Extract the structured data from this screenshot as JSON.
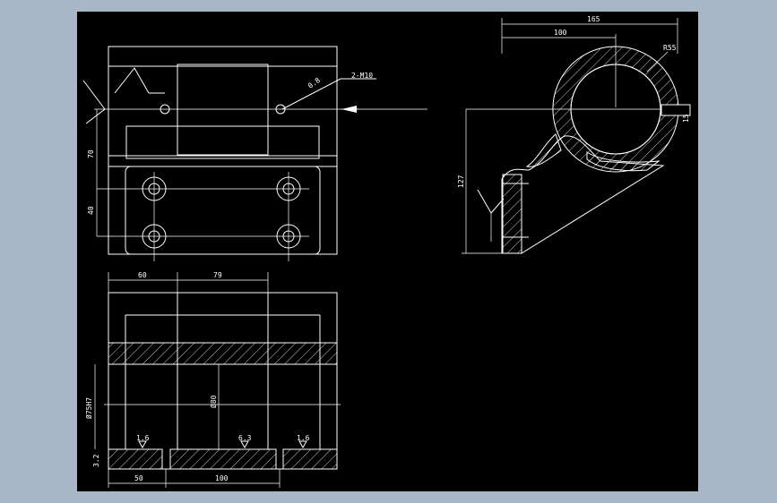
{
  "colors": {
    "background": "#a8b6c8",
    "canvas": "#000000",
    "lines": "#ffffff"
  },
  "top_view": {
    "callout_thread": "2-M10",
    "callout_depth": "0.8",
    "dim_70": "70",
    "dim_40": "40"
  },
  "side_view": {
    "dim_165": "165",
    "dim_100": "100",
    "radius": "R55",
    "dim_15": "15",
    "dim_127": "127"
  },
  "section_view": {
    "dim_60": "60",
    "dim_79": "79",
    "dim_bore_fit": "Ø75H7",
    "dim_bore": "Ø80",
    "rough_left": "1.6",
    "rough_mid": "6.3",
    "rough_right": "1.6",
    "rough_side": "3.2",
    "dim_50": "50",
    "dim_100": "100"
  }
}
